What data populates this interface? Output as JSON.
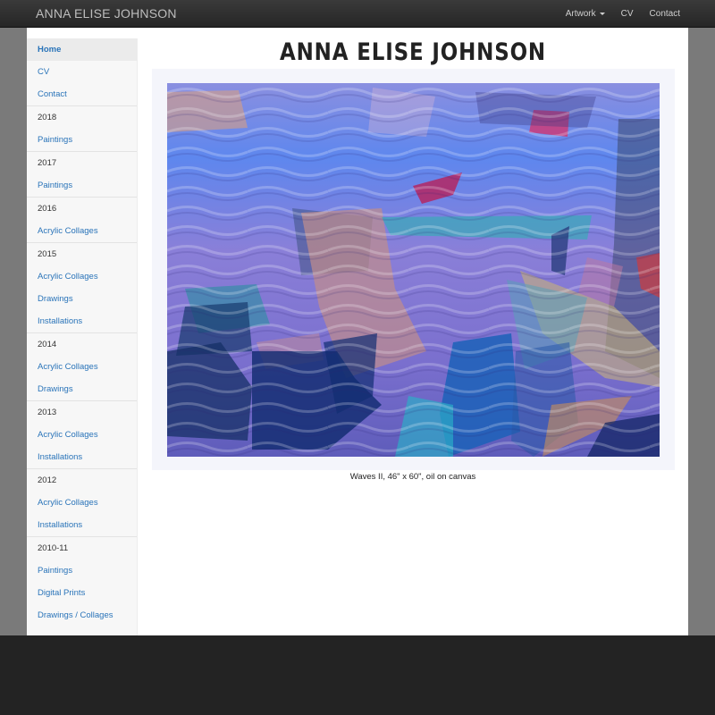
{
  "navbar": {
    "brand": "ANNA ELISE JOHNSON",
    "links": [
      "Artwork",
      "CV",
      "Contact"
    ]
  },
  "sidebar": {
    "home": "Home",
    "cv": "CV",
    "contact": "Contact",
    "groups": [
      {
        "year": "2018",
        "items": [
          "Paintings"
        ]
      },
      {
        "year": "2017",
        "items": [
          "Paintings"
        ]
      },
      {
        "year": "2016",
        "items": [
          "Acrylic Collages"
        ]
      },
      {
        "year": "2015",
        "items": [
          "Acrylic Collages",
          "Drawings",
          "Installations"
        ]
      },
      {
        "year": "2014",
        "items": [
          "Acrylic Collages",
          "Drawings"
        ]
      },
      {
        "year": "2013",
        "items": [
          "Acrylic Collages",
          "Installations"
        ]
      },
      {
        "year": "2012",
        "items": [
          "Acrylic Collages",
          "Installations"
        ]
      },
      {
        "year": "2010-11",
        "items": [
          "Paintings",
          "Digital Prints",
          "Drawings / Collages"
        ]
      }
    ]
  },
  "main": {
    "title": "ANNA ELISE JOHNSON",
    "caption": "Waves II, 46\" x 60\", oil on canvas"
  },
  "colors": {
    "navbar": "#2b2b2b",
    "link": "#2a74b9",
    "backdrop": "#7a7a7a",
    "footer": "#232323"
  }
}
